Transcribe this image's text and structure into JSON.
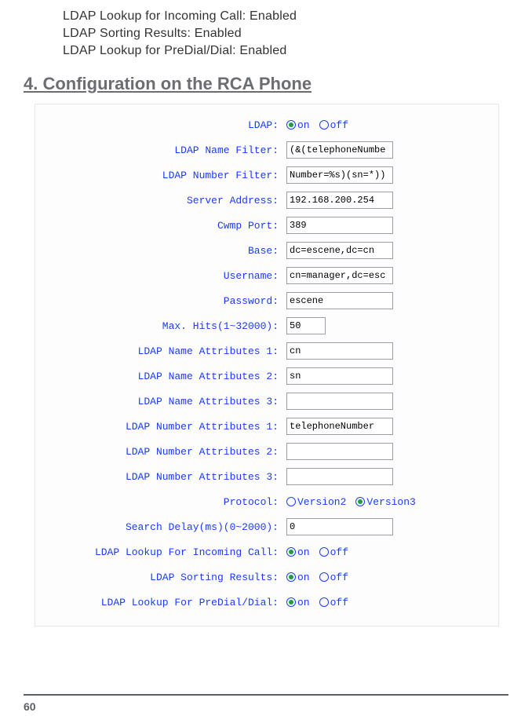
{
  "preamble": {
    "l1": "LDAP Lookup for Incoming Call: Enabled",
    "l2": "LDAP Sorting Results: Enabled",
    "l3": "LDAP Lookup for PreDial/Dial: Enabled"
  },
  "heading": "4. Configuration on the RCA Phone",
  "labels": {
    "ldap": "LDAP:",
    "name_filter": "LDAP Name Filter:",
    "number_filter": "LDAP Number Filter:",
    "server_address": "Server Address:",
    "cwmp_port": "Cwmp Port:",
    "base": "Base:",
    "username": "Username:",
    "password": "Password:",
    "max_hits": "Max. Hits(1~32000):",
    "name_attr1": "LDAP Name Attributes 1:",
    "name_attr2": "LDAP Name Attributes 2:",
    "name_attr3": "LDAP Name Attributes 3:",
    "number_attr1": "LDAP Number Attributes 1:",
    "number_attr2": "LDAP Number Attributes 2:",
    "number_attr3": "LDAP Number Attributes 3:",
    "protocol": "Protocol:",
    "search_delay": "Search Delay(ms)(0~2000):",
    "lookup_incoming": "LDAP Lookup For Incoming Call:",
    "sorting": "LDAP Sorting Results:",
    "lookup_predial": "LDAP Lookup For PreDial/Dial:"
  },
  "values": {
    "name_filter": "(&(telephoneNumbe",
    "number_filter": "Number=%s)(sn=*))",
    "server_address": "192.168.200.254",
    "cwmp_port": "389",
    "base": "dc=escene,dc=cn",
    "username": "cn=manager,dc=esc",
    "password": "escene",
    "max_hits": "50",
    "name_attr1": "cn",
    "name_attr2": "sn",
    "name_attr3": "",
    "number_attr1": "telephoneNumber",
    "number_attr2": "",
    "number_attr3": "",
    "search_delay": "0"
  },
  "radios": {
    "on": "on",
    "off": "off",
    "v2": "Version2",
    "v3": "Version3"
  },
  "page_number": "60"
}
